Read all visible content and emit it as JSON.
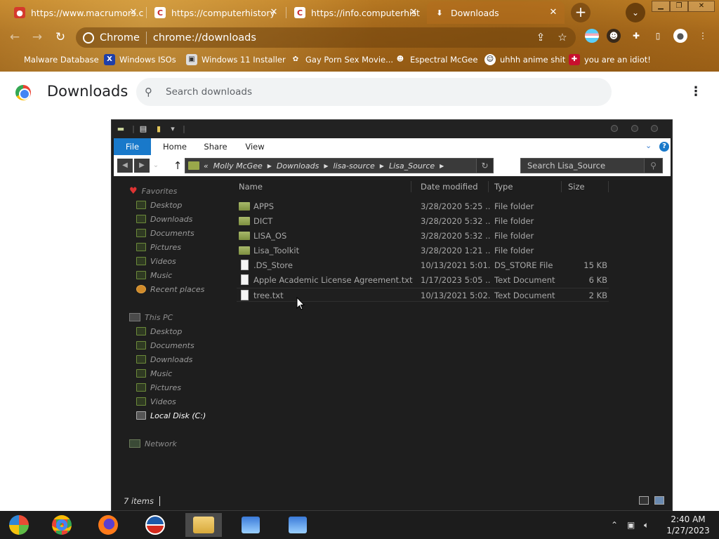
{
  "browser": {
    "tabs": [
      {
        "title": "https://www.macrumors.c",
        "favicon": "macrumors-favicon",
        "active": false
      },
      {
        "title": "https://computerhistory",
        "favicon": "computerhistory-favicon",
        "active": false
      },
      {
        "title": "https://info.computerhist",
        "favicon": "computerhistory-favicon",
        "active": false
      },
      {
        "title": "Downloads",
        "favicon": "download-icon",
        "active": true
      }
    ],
    "new_tab_symbol": "+",
    "site_chip": "Chrome",
    "url": "chrome://downloads",
    "bookmarks": [
      {
        "label": "Malware Database",
        "icon": "apple-icon"
      },
      {
        "label": "Windows ISOs",
        "icon": "x-icon"
      },
      {
        "label": "Windows 11 Installer",
        "icon": "image-icon"
      },
      {
        "label": "Gay Porn Sex Movie...",
        "icon": "bookmark-site-icon"
      },
      {
        "label": "Espectral McGee",
        "icon": "avatar-icon"
      },
      {
        "label": "uhhh anime shit",
        "icon": "anime-icon"
      },
      {
        "label": "you are an idiot!",
        "icon": "flag-icon"
      }
    ]
  },
  "downloads_page": {
    "title": "Downloads",
    "search_placeholder": "Search downloads"
  },
  "explorer": {
    "ribbon_tabs": [
      "File",
      "Home",
      "Share",
      "View"
    ],
    "breadcrumb": [
      "Molly McGee",
      "Downloads",
      "lisa-source",
      "Lisa_Source"
    ],
    "breadcrumb_prefix": "«",
    "search_placeholder": "Search Lisa_Source",
    "nav": {
      "favorites_label": "Favorites",
      "favorites": [
        "Desktop",
        "Downloads",
        "Documents",
        "Pictures",
        "Videos",
        "Music",
        "Recent places"
      ],
      "this_pc_label": "This PC",
      "this_pc": [
        "Desktop",
        "Documents",
        "Downloads",
        "Music",
        "Pictures",
        "Videos",
        "Local Disk (C:)"
      ],
      "network_label": "Network"
    },
    "columns": {
      "name": "Name",
      "date": "Date modified",
      "type": "Type",
      "size": "Size"
    },
    "files": [
      {
        "name": "APPS",
        "date": "3/28/2020 5:25 ...",
        "type": "File folder",
        "size": "",
        "kind": "folder"
      },
      {
        "name": "DICT",
        "date": "3/28/2020 5:32 ...",
        "type": "File folder",
        "size": "",
        "kind": "folder"
      },
      {
        "name": "LISA_OS",
        "date": "3/28/2020 5:32 ...",
        "type": "File folder",
        "size": "",
        "kind": "folder"
      },
      {
        "name": "Lisa_Toolkit",
        "date": "3/28/2020 1:21 ...",
        "type": "File folder",
        "size": "",
        "kind": "folder"
      },
      {
        "name": ".DS_Store",
        "date": "10/13/2021 5:01...",
        "type": "DS_STORE File",
        "size": "15 KB",
        "kind": "file"
      },
      {
        "name": "Apple Academic License Agreement.txt",
        "date": "1/17/2023 5:05 ...",
        "type": "Text Document",
        "size": "6 KB",
        "kind": "file"
      },
      {
        "name": "tree.txt",
        "date": "10/13/2021 5:02...",
        "type": "Text Document",
        "size": "2 KB",
        "kind": "file"
      }
    ],
    "status": "7 items"
  },
  "taskbar": {
    "apps": [
      "windows-start-icon",
      "chrome-icon",
      "firefox-icon",
      "obama-logo-icon",
      "file-explorer-icon",
      "network-computer-icon",
      "network-computer-icon"
    ],
    "time": "2:40 AM",
    "date": "1/27/2023"
  }
}
